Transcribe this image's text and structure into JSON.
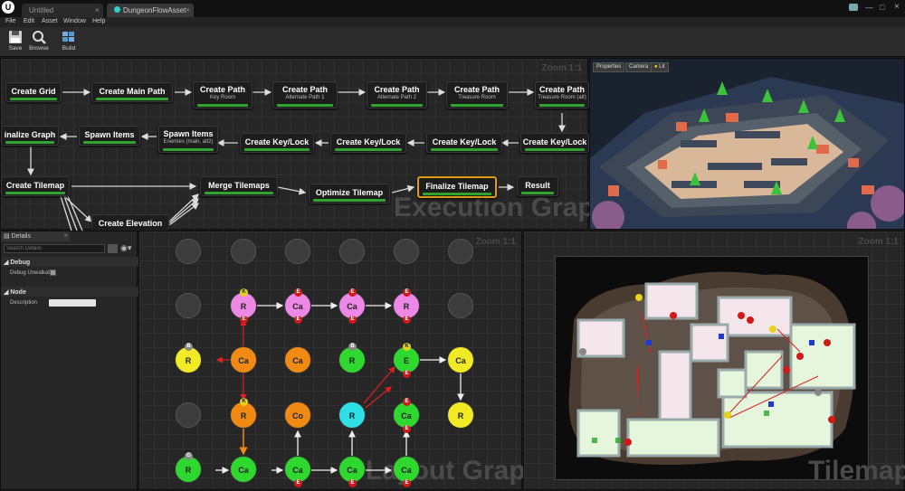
{
  "tabs": {
    "untitled": "Untitled",
    "asset": "DungeonFlowAsset"
  },
  "menu": [
    "File",
    "Edit",
    "Asset",
    "Window",
    "Help"
  ],
  "toolbar": {
    "save": "Save",
    "browse": "Browse",
    "build": "Build"
  },
  "execution": {
    "zoom": "Zoom 1:1",
    "watermark": "Execution Graph",
    "nodes": {
      "create_grid": "Create Grid",
      "create_main_path": "Create Main Path",
      "cp_key": {
        "title": "Create Path",
        "sub": "Key Room"
      },
      "cp_alt1": {
        "title": "Create Path",
        "sub": "Alternate Path 1"
      },
      "cp_alt2": {
        "title": "Create Path",
        "sub": "Alternate Path 2"
      },
      "cp_treasure": {
        "title": "Create Path",
        "sub": "Treasure Room"
      },
      "cp_treasure_alt": {
        "title": "Create Path",
        "sub": "Treasure Room (alt)"
      },
      "finalize_graph": "inalize Graph",
      "spawn_items": "Spawn Items",
      "spawn_enemies": {
        "title": "Spawn Items",
        "sub": "Enemies (main, alt2)"
      },
      "kl1": "Create Key/Lock",
      "kl2": "Create Key/Lock",
      "kl3": "Create Key/Lock",
      "kl4": "Create Key/Lock",
      "create_tilemap": "Create Tilemap",
      "merge_tilemaps": "Merge Tilemaps",
      "optimize_tilemap": "Optimize Tilemap",
      "finalize_tilemap": "Finalize Tilemap",
      "result": "Result",
      "create_elevation": "Create Elevation"
    }
  },
  "viewport": {
    "properties": "Properties",
    "camera": "Camera",
    "lit": "Lit"
  },
  "details": {
    "tab": "Details",
    "search_placeholder": "Search Details",
    "debug_section": "Debug",
    "debug_label": "Debug Unwalkab",
    "node_section": "Node",
    "description_label": "Description"
  },
  "layout": {
    "zoom": "Zoom 1:1",
    "watermark": "Layout Graph",
    "rooms": [
      {
        "label": "R",
        "color": "#ee88e6",
        "top": "K",
        "bottom": "E"
      },
      {
        "label": "Ca",
        "color": "#ee88e6",
        "top": "E",
        "bottom": "E"
      },
      {
        "label": "Ca",
        "color": "#ee88e6",
        "top": "E",
        "bottom": "E"
      },
      {
        "label": "R",
        "color": "#ee88e6",
        "top": "E",
        "bottom": "E"
      },
      {
        "label": "R",
        "color": "#f2ea24",
        "top": "B",
        "bottom": ""
      },
      {
        "label": "Ca",
        "color": "#f08a12",
        "top": "",
        "bottom": ""
      },
      {
        "label": "Ca",
        "color": "#f08a12",
        "top": "",
        "bottom": ""
      },
      {
        "label": "R",
        "color": "#2fd82f",
        "top": "B",
        "bottom": ""
      },
      {
        "label": "E",
        "color": "#2fd82f",
        "top": "K",
        "bottom": "E"
      },
      {
        "label": "Ca",
        "color": "#f2ea24",
        "top": "",
        "bottom": ""
      },
      {
        "label": "R",
        "color": "#f08a12",
        "top": "K",
        "bottom": ""
      },
      {
        "label": "Co",
        "color": "#f08a12",
        "top": "",
        "bottom": ""
      },
      {
        "label": "R",
        "color": "#2ee0e6",
        "top": "",
        "bottom": ""
      },
      {
        "label": "Ca",
        "color": "#2fd82f",
        "top": "E",
        "bottom": "E"
      },
      {
        "label": "R",
        "color": "#f2ea24",
        "top": "",
        "bottom": ""
      },
      {
        "label": "R",
        "color": "#2fd82f",
        "top": "G",
        "bottom": ""
      },
      {
        "label": "Ca",
        "color": "#2fd82f",
        "top": "",
        "bottom": ""
      },
      {
        "label": "Ca",
        "color": "#2fd82f",
        "top": "",
        "bottom": "E"
      },
      {
        "label": "Ca",
        "color": "#2fd82f",
        "top": "",
        "bottom": "E"
      },
      {
        "label": "Ca",
        "color": "#2fd82f",
        "top": "",
        "bottom": "E"
      }
    ]
  },
  "tilemap": {
    "zoom": "Zoom 1:1",
    "watermark": "Tilemap"
  },
  "colors": {
    "accent_green": "#2fa52f",
    "selection": "#e09a1a",
    "background": "#1b1b1b"
  },
  "icons": [
    "save-icon",
    "browse-icon",
    "build-icon",
    "search-icon",
    "eye-icon",
    "grid-view-icon",
    "collapse-arrow-icon",
    "close-icon"
  ]
}
